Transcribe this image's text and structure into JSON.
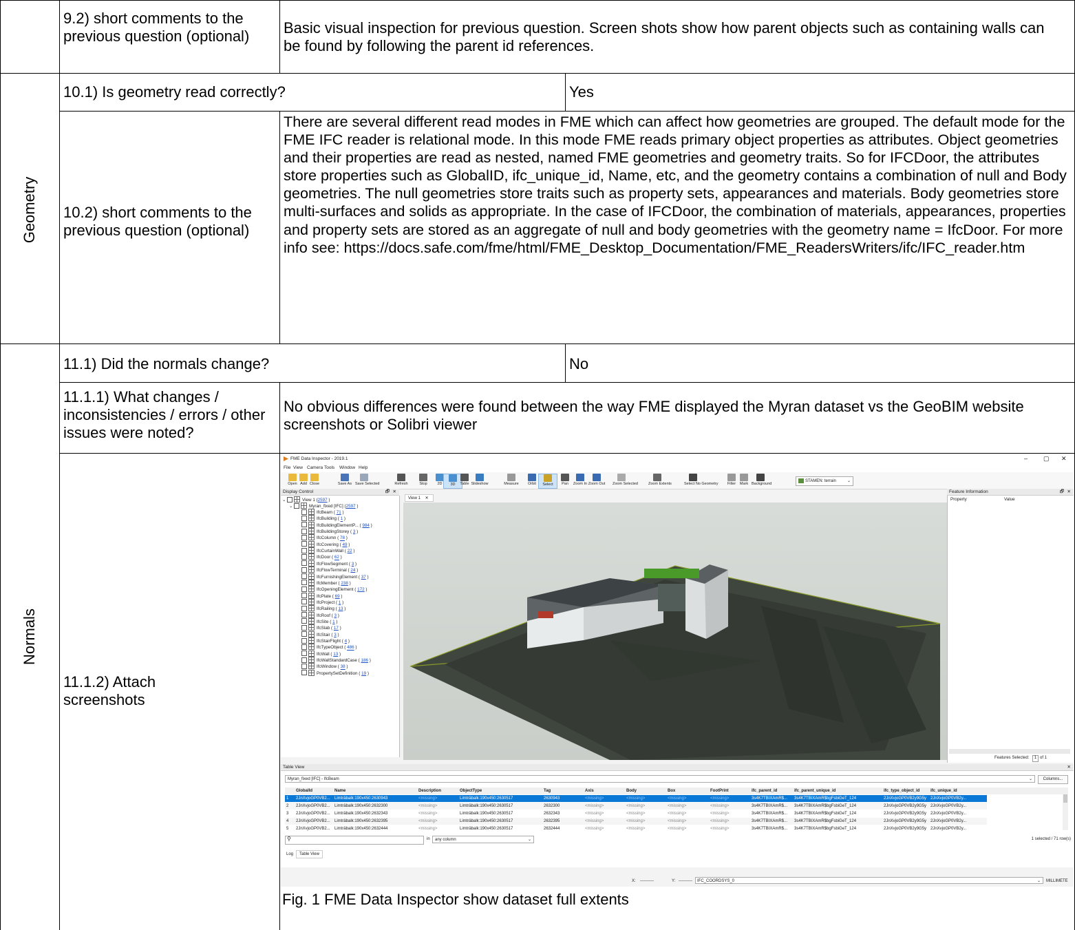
{
  "rows": {
    "q9_2": {
      "question": "9.2) short comments to the previous question (optional)",
      "answer": "Basic visual inspection for previous question. Screen shots show how parent objects such as containing walls can be found by following the parent id references."
    },
    "geometry_section": "Geometry",
    "q10_1": {
      "question": "10.1) Is geometry read correctly?",
      "answer": "Yes"
    },
    "q10_2": {
      "question": "10.2) short comments to the previous question (optional)",
      "answer": "There are several different read modes in FME which can affect how geometries are grouped. The default mode for the FME IFC reader is relational mode. In this mode FME reads primary object properties as attributes. Object geometries and their properties are read as nested, named FME geometries and geometry traits. So for IFCDoor, the attributes store properties such as GlobalID, ifc_unique_id, Name, etc, and the geometry contains a combination of null and Body geometries. The null geometries store traits such as property sets, appearances and materials. Body geometries store multi-surfaces and solids as appropriate. In the case of IFCDoor, the combination of materials, appearances, properties and property sets are stored as an aggregate of null and body geometries with the geometry name = IfcDoor. For more info see: https://docs.safe.com/fme/html/FME_Desktop_Documentation/FME_ReadersWriters/ifc/IFC_reader.htm"
    },
    "normals_section": "Normals",
    "q11_1": {
      "question": "11.1) Did the normals change?",
      "answer": "No"
    },
    "q11_1_1": {
      "question": "11.1.1) What changes / inconsistencies / errors / other issues were noted?",
      "answer": "No obvious differences were found between the way FME displayed the Myran dataset vs the GeoBIM website screenshots or Solibri viewer"
    },
    "q11_1_2": {
      "question": "11.1.2) Attach screenshots",
      "caption": "Fig. 1 FME Data Inspector show dataset full extents"
    }
  },
  "screenshot": {
    "window_title": "FME Data Inspector - 2019.1",
    "window_controls": [
      "–",
      "▢",
      "✕"
    ],
    "menu": [
      "File",
      "View",
      "Camera",
      "Tools",
      "Window",
      "Help"
    ],
    "toolbar": [
      {
        "label": "Open",
        "icon": "folder-icon"
      },
      {
        "label": "Add",
        "icon": "add-icon"
      },
      {
        "label": "Close",
        "icon": "folder-close-icon"
      },
      {
        "label": "Save As",
        "icon": "save-icon"
      },
      {
        "label": "Save Selected",
        "icon": "save-selected-icon"
      },
      {
        "label": "Refresh",
        "icon": "refresh-icon"
      },
      {
        "label": "Stop",
        "icon": "stop-icon"
      },
      {
        "label": "2D",
        "icon": "2d-icon"
      },
      {
        "label": "3D",
        "icon": "3d-icon"
      },
      {
        "label": "Table",
        "icon": "table-icon"
      },
      {
        "label": "Slideshow",
        "icon": "slideshow-icon"
      },
      {
        "label": "Measure",
        "icon": "measure-icon"
      },
      {
        "label": "Orbit",
        "icon": "orbit-icon"
      },
      {
        "label": "Select",
        "icon": "select-icon"
      },
      {
        "label": "Pan",
        "icon": "pan-icon"
      },
      {
        "label": "Zoom In",
        "icon": "zoom-in-icon"
      },
      {
        "label": "Zoom Out",
        "icon": "zoom-out-icon"
      },
      {
        "label": "Zoom Selected",
        "icon": "zoom-selected-icon"
      },
      {
        "label": "Zoom Extents",
        "icon": "zoom-extents-icon"
      },
      {
        "label": "Select No Geometry",
        "icon": "select-no-geometry-icon"
      },
      {
        "label": "Filter",
        "icon": "filter-icon"
      },
      {
        "label": "Mark",
        "icon": "mark-icon"
      },
      {
        "label": "Background",
        "icon": "background-icon"
      }
    ],
    "basemap_select": "STAMEN: terrain",
    "display_control": {
      "title": "Display Control",
      "view_label": "View 1 (",
      "view_count": "2597",
      "dataset_label": "Myran_fixed [IFC] (",
      "dataset_count": "2597",
      "layers": [
        {
          "name": "IfcBeam",
          "count": "71"
        },
        {
          "name": "IfcBuilding",
          "count": "1"
        },
        {
          "name": "IfcBuildingElementP...",
          "count": "984"
        },
        {
          "name": "IfcBuildingStorey",
          "count": "3"
        },
        {
          "name": "IfcColumn",
          "count": "78"
        },
        {
          "name": "IfcCovering",
          "count": "49"
        },
        {
          "name": "IfcCurtainWall",
          "count": "22"
        },
        {
          "name": "IfcDoor",
          "count": "62"
        },
        {
          "name": "IfcFlowSegment",
          "count": "3"
        },
        {
          "name": "IfcFlowTerminal",
          "count": "24"
        },
        {
          "name": "IfcFurnishingElement",
          "count": "37"
        },
        {
          "name": "IfcMember",
          "count": "238"
        },
        {
          "name": "IfcOpeningElement",
          "count": "172"
        },
        {
          "name": "IfcPlate",
          "count": "69"
        },
        {
          "name": "IfcProject",
          "count": "1"
        },
        {
          "name": "IfcRailing",
          "count": "13"
        },
        {
          "name": "IfcRoof",
          "count": "3"
        },
        {
          "name": "IfcSite",
          "count": "1"
        },
        {
          "name": "IfcSlab",
          "count": "17"
        },
        {
          "name": "IfcStair",
          "count": "3"
        },
        {
          "name": "IfcStairFlight",
          "count": "4"
        },
        {
          "name": "IfcTypeObject",
          "count": "486"
        },
        {
          "name": "IfcWall",
          "count": "13"
        },
        {
          "name": "IfcWallStandardCase",
          "count": "186"
        },
        {
          "name": "IfcWindow",
          "count": "38"
        },
        {
          "name": "PropertySetDefinition",
          "count": "19"
        }
      ]
    },
    "view_tab": "View 1",
    "feature_info": {
      "title": "Feature Information",
      "col_property": "Property",
      "col_value": "Value",
      "features_selected_label": "Features Selected:",
      "page": "1",
      "of": "of 1"
    },
    "table_view": {
      "title": "Table View",
      "dataset_select": "Myran_fixed [IFC] - IfcBeam",
      "columns_button": "Columns...",
      "headers": [
        "GlobalId",
        "Name",
        "Description",
        "ObjectType",
        "Tag",
        "Axis",
        "Body",
        "Box",
        "FootPrint",
        "ifc_parent_id",
        "ifc_parent_unique_id",
        "ifc_type_object_id",
        "ifc_unique_id"
      ],
      "rows": [
        {
          "n": "1",
          "cells": [
            "2JnXvjoGP0VB2...",
            "Limträbalk:190x450:2630943",
            "<missing>",
            "Limträbalk:190x450:2630517",
            "2630943",
            "<missing>",
            "<missing>",
            "<missing>",
            "<missing>",
            "3s4K7TBIXAmR$...",
            "3s4K7TBIXAmR$bgFsbiGeT_124",
            "2JnXvjoGP0VB2y9G5y...",
            "2JnXvjoGP0VB2y..."
          ]
        },
        {
          "n": "2",
          "cells": [
            "2JnXvjoGP0VB2...",
            "Limträbalk:190x450:2632300",
            "<missing>",
            "Limträbalk:190x450:2630517",
            "2632300",
            "<missing>",
            "<missing>",
            "<missing>",
            "<missing>",
            "3s4K7TBIXAmR$...",
            "3s4K7TBIXAmR$bgFsbiGeT_124",
            "2JnXvjoGP0VB2y9G5y...",
            "2JnXvjoGP0VB2y..."
          ]
        },
        {
          "n": "3",
          "cells": [
            "2JnXvjoGP0VB2...",
            "Limträbalk:190x450:2632343",
            "<missing>",
            "Limträbalk:190x450:2630517",
            "2632343",
            "<missing>",
            "<missing>",
            "<missing>",
            "<missing>",
            "3s4K7TBIXAmR$...",
            "3s4K7TBIXAmR$bgFsbiGeT_124",
            "2JnXvjoGP0VB2y9G5y...",
            "2JnXvjoGP0VB2y..."
          ]
        },
        {
          "n": "4",
          "cells": [
            "2JnXvjoGP0VB2...",
            "Limträbalk:190x450:2632395",
            "<missing>",
            "Limträbalk:190x450:2630517",
            "2632395",
            "<missing>",
            "<missing>",
            "<missing>",
            "<missing>",
            "3s4K7TBIXAmR$...",
            "3s4K7TBIXAmR$bgFsbiGeT_124",
            "2JnXvjoGP0VB2y9G5y...",
            "2JnXvjoGP0VB2y..."
          ]
        },
        {
          "n": "5",
          "cells": [
            "2JnXvjoGP0VB2...",
            "Limträbalk:190x450:2632444",
            "<missing>",
            "Limträbalk:190x450:2630517",
            "2632444",
            "<missing>",
            "<missing>",
            "<missing>",
            "<missing>",
            "3s4K7TBIXAmR$...",
            "3s4K7TBIXAmR$bgFsbiGeT_124",
            "2JnXvjoGP0VB2y9G5y...",
            "2JnXvjoGP0VB2y..."
          ]
        }
      ],
      "search_in_label": "in",
      "search_column_select": "any column",
      "selected_count": "1 selected / 71 row(s)"
    },
    "bottom_tabs": [
      "Log",
      "Table View"
    ],
    "status": {
      "x_label": "X:",
      "x_value": "----------",
      "y_label": "Y:",
      "y_value": "----------",
      "coordsys": "IFC_COORDSYS_0",
      "units": "MILLIMETE"
    },
    "colors": {
      "selection": "#0a78d7",
      "accent": "#1a4fc2",
      "terrain": "#3b4236"
    }
  }
}
